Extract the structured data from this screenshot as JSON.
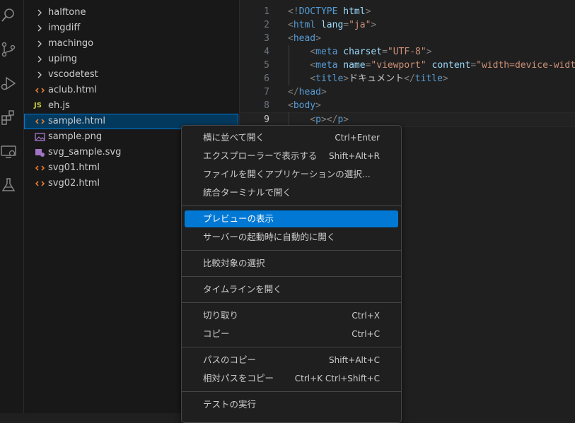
{
  "explorer": {
    "items": [
      {
        "label": "halftone",
        "icon": "chevron-right-icon",
        "kind": "folder"
      },
      {
        "label": "imgdiff",
        "icon": "chevron-right-icon",
        "kind": "folder"
      },
      {
        "label": "machingo",
        "icon": "chevron-right-icon",
        "kind": "folder"
      },
      {
        "label": "upimg",
        "icon": "chevron-right-icon",
        "kind": "folder"
      },
      {
        "label": "vscodetest",
        "icon": "chevron-right-icon",
        "kind": "folder"
      },
      {
        "label": "aclub.html",
        "icon": "html-file-icon",
        "kind": "html"
      },
      {
        "label": "eh.js",
        "icon": "js-file-icon",
        "glyph": "JS",
        "kind": "js"
      },
      {
        "label": "sample.html",
        "icon": "html-file-icon",
        "kind": "html",
        "selected": true
      },
      {
        "label": "sample.png",
        "icon": "image-file-icon",
        "kind": "png"
      },
      {
        "label": "svg_sample.svg",
        "icon": "svg-file-icon",
        "kind": "svg"
      },
      {
        "label": "svg01.html",
        "icon": "html-file-icon",
        "kind": "html"
      },
      {
        "label": "svg02.html",
        "icon": "html-file-icon",
        "kind": "html"
      }
    ]
  },
  "activity_icons": [
    "search-icon",
    "source-control-icon",
    "run-debug-icon",
    "extensions-icon",
    "remote-explorer-icon",
    "testing-icon"
  ],
  "editor": {
    "line_numbers": [
      "1",
      "2",
      "3",
      "4",
      "5",
      "6",
      "7",
      "8",
      "9"
    ],
    "current_line": "9",
    "lines": [
      [
        [
          "punc",
          "<!"
        ],
        [
          "tag",
          "DOCTYPE"
        ],
        [
          "text",
          " "
        ],
        [
          "attr",
          "html"
        ],
        [
          "punc",
          ">"
        ]
      ],
      [
        [
          "punc",
          "<"
        ],
        [
          "tag",
          "html"
        ],
        [
          "text",
          " "
        ],
        [
          "attr",
          "lang"
        ],
        [
          "punc",
          "="
        ],
        [
          "str",
          "\"ja\""
        ],
        [
          "punc",
          ">"
        ]
      ],
      [
        [
          "punc",
          "<"
        ],
        [
          "tag",
          "head"
        ],
        [
          "punc",
          ">"
        ]
      ],
      [
        [
          "text",
          "    "
        ],
        [
          "punc",
          "<"
        ],
        [
          "tag",
          "meta"
        ],
        [
          "text",
          " "
        ],
        [
          "attr",
          "charset"
        ],
        [
          "punc",
          "="
        ],
        [
          "str",
          "\"UTF-8\""
        ],
        [
          "punc",
          ">"
        ]
      ],
      [
        [
          "text",
          "    "
        ],
        [
          "punc",
          "<"
        ],
        [
          "tag",
          "meta"
        ],
        [
          "text",
          " "
        ],
        [
          "attr",
          "name"
        ],
        [
          "punc",
          "="
        ],
        [
          "str",
          "\"viewport\""
        ],
        [
          "text",
          " "
        ],
        [
          "attr",
          "content"
        ],
        [
          "punc",
          "="
        ],
        [
          "str",
          "\"width=device-width"
        ]
      ],
      [
        [
          "text",
          "    "
        ],
        [
          "punc",
          "<"
        ],
        [
          "tag",
          "title"
        ],
        [
          "punc",
          ">"
        ],
        [
          "text",
          "ドキュメント"
        ],
        [
          "punc",
          "</"
        ],
        [
          "tag",
          "title"
        ],
        [
          "punc",
          ">"
        ]
      ],
      [
        [
          "punc",
          "</"
        ],
        [
          "tag",
          "head"
        ],
        [
          "punc",
          ">"
        ]
      ],
      [
        [
          "punc",
          "<"
        ],
        [
          "tag",
          "body"
        ],
        [
          "punc",
          ">"
        ]
      ],
      [
        [
          "text",
          "    "
        ],
        [
          "punc",
          "<"
        ],
        [
          "tag",
          "p"
        ],
        [
          "punc",
          "></"
        ],
        [
          "tag",
          "p"
        ],
        [
          "punc",
          ">"
        ]
      ]
    ]
  },
  "context_menu": {
    "highlighted_index": 4,
    "items": [
      {
        "label": "横に並べて開く",
        "shortcut": "Ctrl+Enter"
      },
      {
        "label": "エクスプローラーで表示する",
        "shortcut": "Shift+Alt+R"
      },
      {
        "label": "ファイルを開くアプリケーションの選択...",
        "shortcut": ""
      },
      {
        "label": "統合ターミナルで開く",
        "shortcut": ""
      },
      {
        "label": "プレビューの表示",
        "shortcut": ""
      },
      {
        "label": "サーバーの起動時に自動的に開く",
        "shortcut": ""
      },
      {
        "label": "比較対象の選択",
        "shortcut": ""
      },
      {
        "label": "タイムラインを開く",
        "shortcut": ""
      },
      {
        "label": "切り取り",
        "shortcut": "Ctrl+X"
      },
      {
        "label": "コピー",
        "shortcut": "Ctrl+C"
      },
      {
        "label": "パスのコピー",
        "shortcut": "Shift+Alt+C"
      },
      {
        "label": "相対パスをコピー",
        "shortcut": "Ctrl+K Ctrl+Shift+C"
      },
      {
        "label": "テストの実行",
        "shortcut": ""
      }
    ]
  },
  "colors": {
    "accent": "#0078d4",
    "selection": "#04395e",
    "html_icon": "#e37933",
    "js_icon": "#cbcb41",
    "image_icon": "#a074c4"
  }
}
